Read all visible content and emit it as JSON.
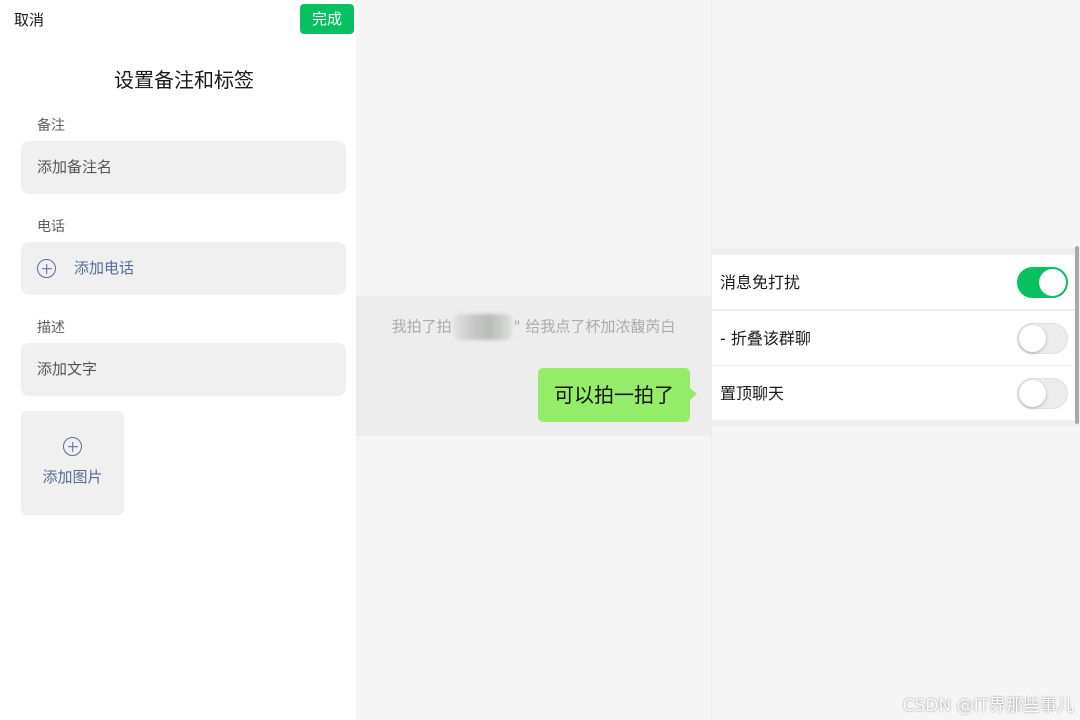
{
  "remark_panel": {
    "cancel_label": "取消",
    "done_label": "完成",
    "title": "设置备注和标签",
    "remark": {
      "label": "备注",
      "placeholder": "添加备注名"
    },
    "phone": {
      "label": "电话",
      "add_label": "添加电话"
    },
    "description": {
      "label": "描述",
      "placeholder": "添加文字"
    },
    "add_image_label": "添加图片"
  },
  "chat": {
    "system_message_prefix": "我拍了拍",
    "system_message_suffix": "\" 给我点了杯加浓馥芮白",
    "bubble_text": "可以拍一拍了"
  },
  "chat_settings": {
    "rows": [
      {
        "label": "消息免打扰",
        "enabled": true
      },
      {
        "label": "- 折叠该群聊",
        "enabled": false
      },
      {
        "label": "置顶聊天",
        "enabled": false
      }
    ]
  },
  "colors": {
    "accent_green": "#07c160",
    "bubble_green": "#95ec69",
    "link_blue": "#576b95"
  },
  "icons": [
    "add-circle-icon",
    "add-image-icon"
  ],
  "watermark": "CSDN @IT界那些事儿"
}
